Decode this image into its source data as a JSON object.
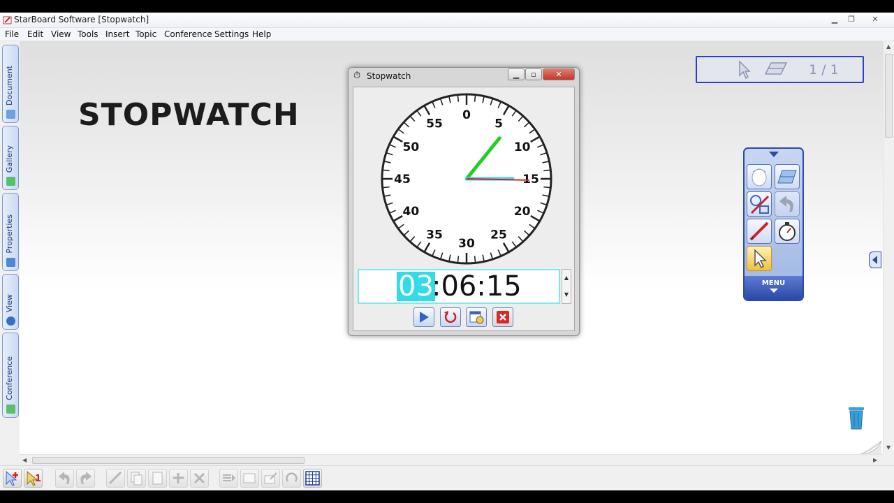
{
  "window": {
    "title": "StarBoard Software [Stopwatch]"
  },
  "menu": [
    "File",
    "Edit",
    "View",
    "Tools",
    "Insert",
    "Topic",
    "Conference",
    "Settings",
    "Help"
  ],
  "side_tabs": [
    {
      "label": "Document"
    },
    {
      "label": "Gallery"
    },
    {
      "label": "Properties"
    },
    {
      "label": "View"
    },
    {
      "label": "Conference"
    }
  ],
  "canvas": {
    "heading": "STOPWATCH"
  },
  "page_nav": {
    "page_indicator": "1 / 1"
  },
  "palette": {
    "menu_label": "MENU"
  },
  "stopwatch": {
    "title": "Stopwatch",
    "hours": "03",
    "rest": ":06:15",
    "dial_numbers": [
      "0",
      "5",
      "10",
      "15",
      "20",
      "25",
      "30",
      "35",
      "40",
      "45",
      "50",
      "55"
    ],
    "hand_minute_seconds": 6.5,
    "hand_seconds_value": 15.2,
    "hand_hour_value": 15,
    "colors": {
      "minute_hand": "#20d020",
      "second_hand": "#e02020",
      "hour_hand": "#30d8e8",
      "highlight": "#33dbe6"
    }
  },
  "bottom_toolbar": [
    "new-page",
    "pointer-page",
    "undo",
    "redo",
    "edit",
    "copy",
    "paste",
    "add",
    "delete",
    "send",
    "frame",
    "export",
    "rotate",
    "grid"
  ]
}
